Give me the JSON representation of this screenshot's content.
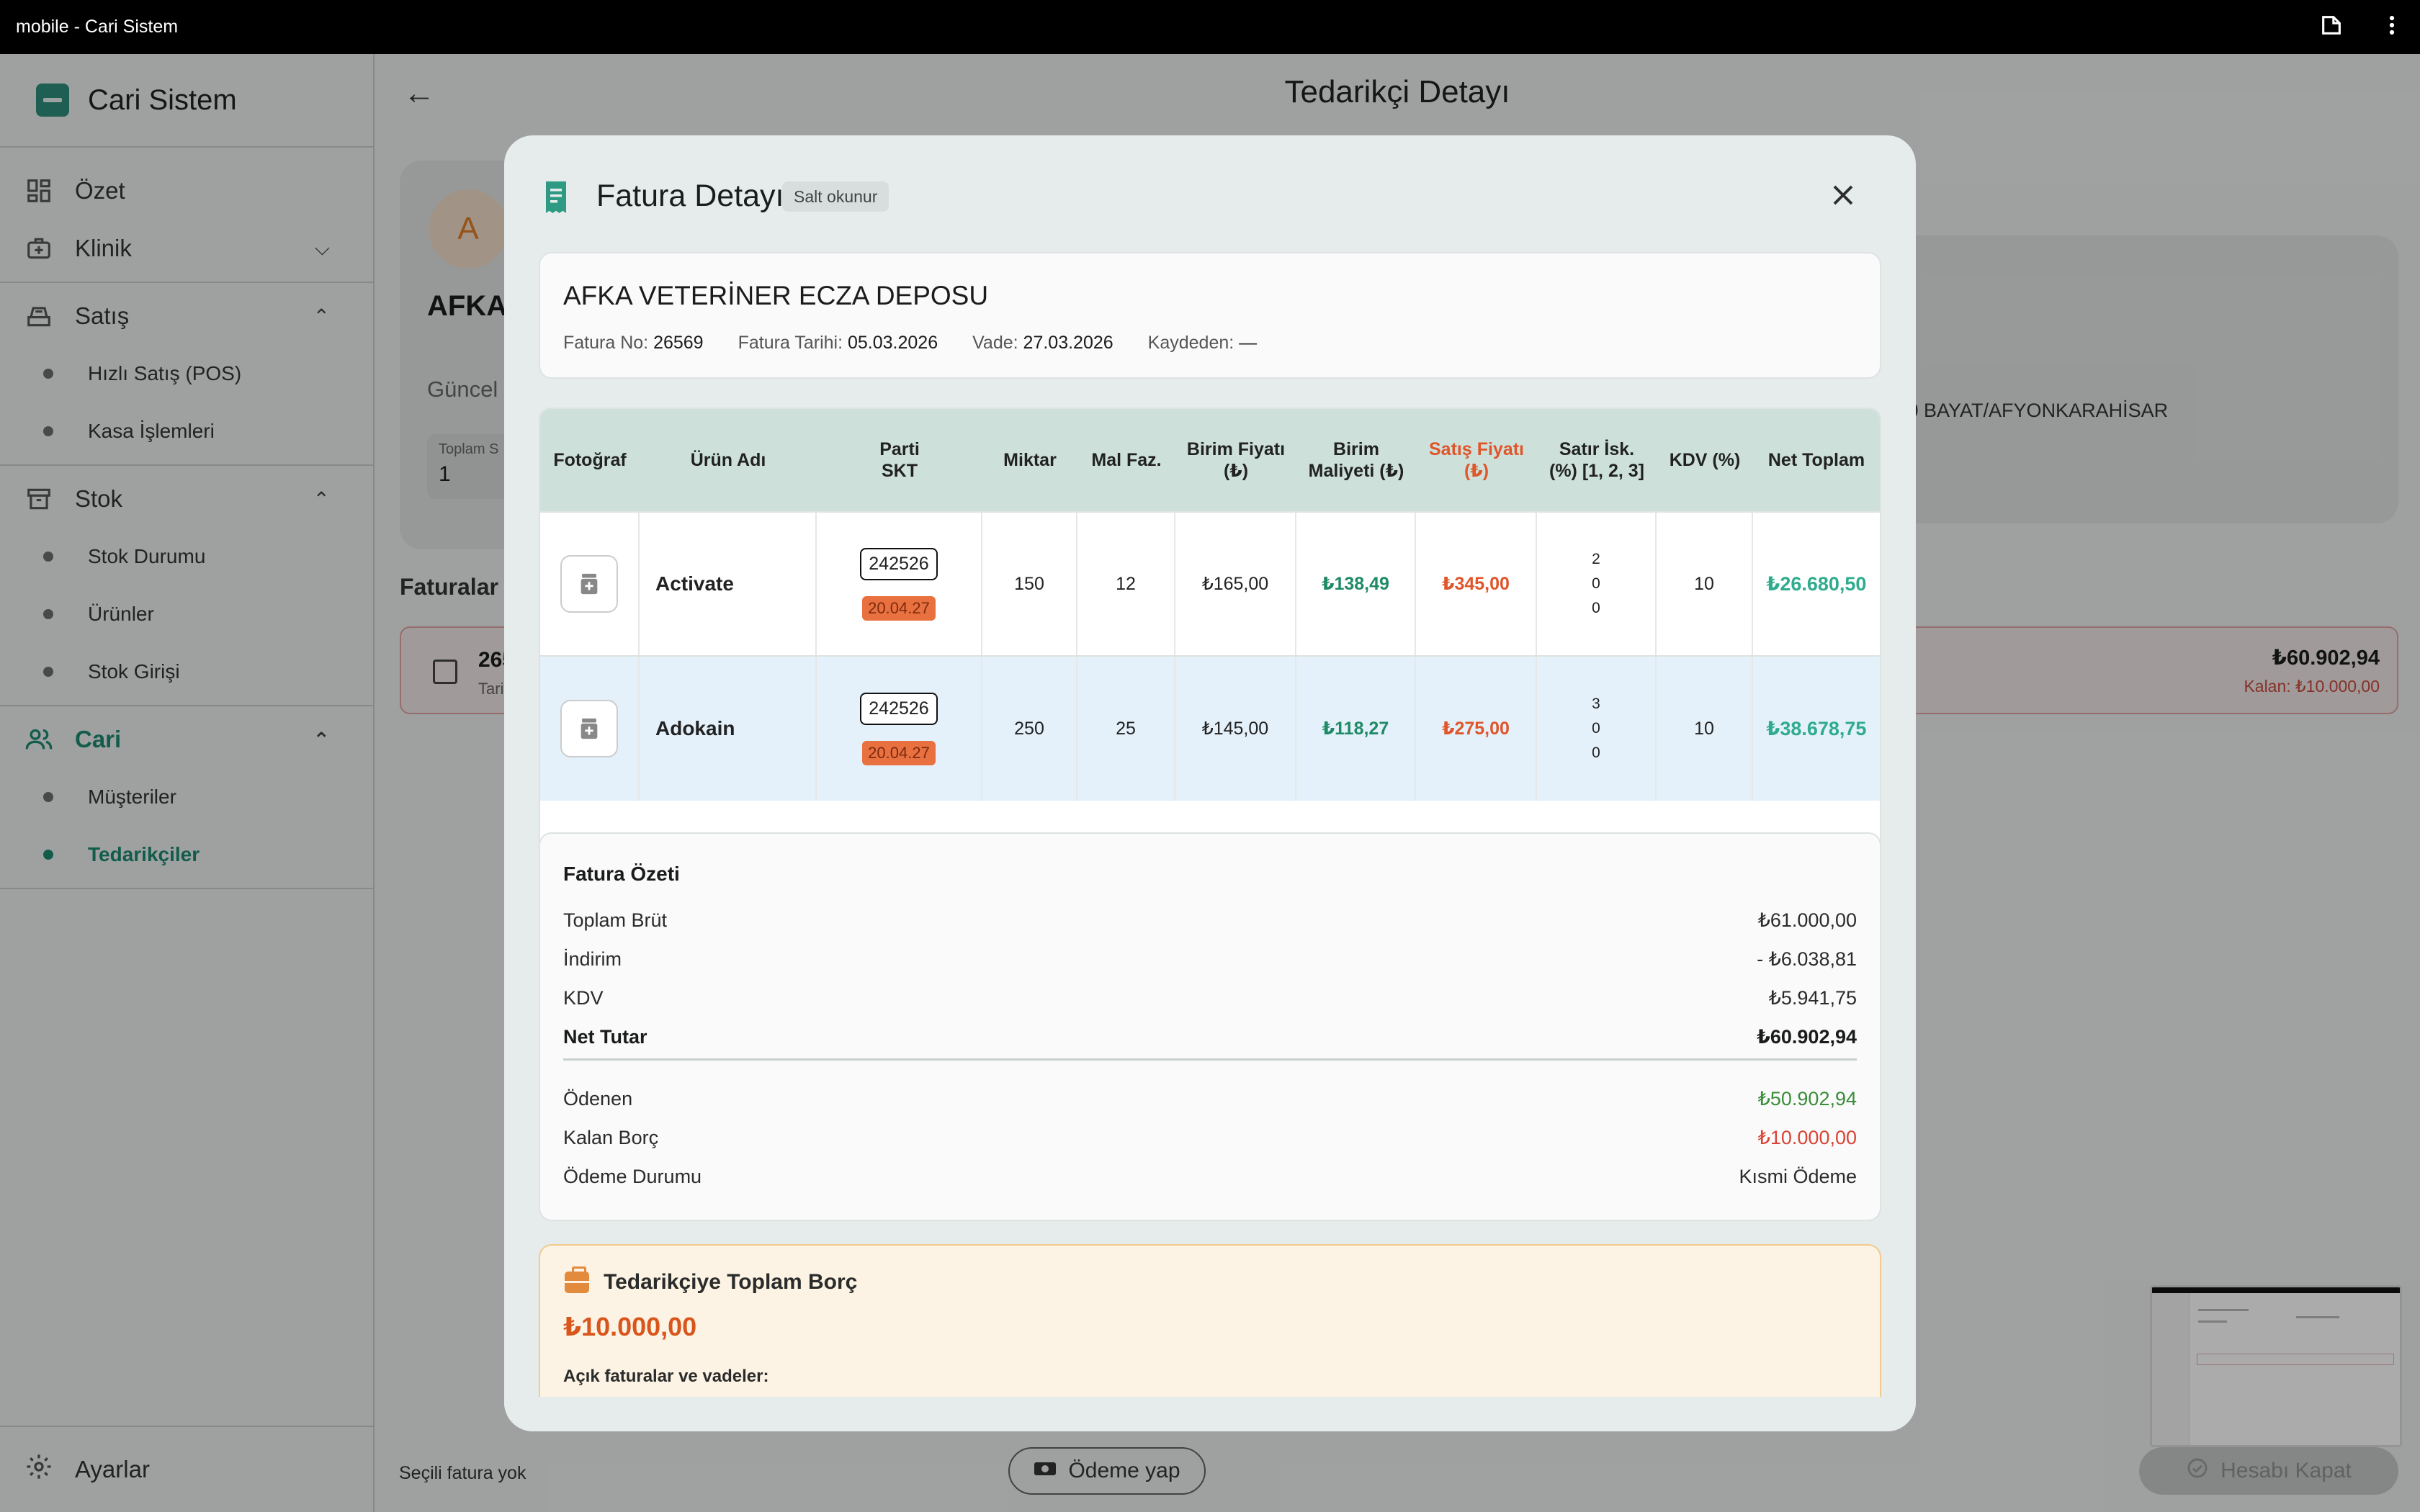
{
  "system_bar": {
    "title": "mobile - Cari Sistem",
    "icons": [
      "rotate-icon",
      "more-vert-icon"
    ]
  },
  "sidebar": {
    "app_name": "Cari Sistem",
    "items": [
      {
        "label": "Özet",
        "icon": "dashboard-icon"
      },
      {
        "label": "Klinik",
        "icon": "medical-bag-icon",
        "expanded": false
      },
      {
        "label": "Satış",
        "icon": "cash-register-icon",
        "expanded": true,
        "children": [
          "Hızlı Satış (POS)",
          "Kasa İşlemleri"
        ]
      },
      {
        "label": "Stok",
        "icon": "archive-icon",
        "expanded": true,
        "children": [
          "Stok Durumu",
          "Ürünler",
          "Stok Girişi"
        ]
      },
      {
        "label": "Cari",
        "icon": "people-icon",
        "expanded": true,
        "active": true,
        "children": [
          "Müşteriler",
          "Tedarikçiler"
        ]
      }
    ],
    "settings_label": "Ayarlar"
  },
  "page": {
    "title": "Tedarikçi Detayı",
    "supplier_avatar": "A",
    "supplier_short": "AFKA",
    "guncel_label": "Güncel",
    "total_label": "Toplam S",
    "total_value": "1",
    "address_fragment": "l 10 BAYAT/AFYONKARAHİSAR",
    "invoices_heading": "Faturalar",
    "invoice_row": {
      "no_fragment": "265",
      "date_fragment": "Tari",
      "amount": "₺60.902,94",
      "remaining": "Kalan: ₺10.000,00"
    },
    "bottom": {
      "selected_text": "Seçili fatura yok",
      "pay_button": "Ödeme yap",
      "close_account_button": "Hesabı Kapat"
    }
  },
  "modal": {
    "title": "Fatura Detayı",
    "badge": "Salt okunur",
    "supplier_name": "AFKA VETERİNER ECZA DEPOSU",
    "meta": [
      {
        "label": "Fatura No:",
        "value": "26569"
      },
      {
        "label": "Fatura Tarihi:",
        "value": "05.03.2026"
      },
      {
        "label": "Vade:",
        "value": "27.03.2026"
      },
      {
        "label": "Kaydeden:",
        "value": "—"
      }
    ],
    "table": {
      "headers": [
        "Fotoğraf",
        "Ürün Adı",
        "Parti\nSKT",
        "Miktar",
        "Mal Faz.",
        "Birim Fiyatı\n(₺)",
        "Birim\nMaliyeti (₺)",
        "Satış Fiyatı\n(₺)",
        "Satır İsk.\n(%) [1, 2, 3]",
        "KDV (%)",
        "Net Toplam"
      ],
      "rows": [
        {
          "product": "Activate",
          "lot": "242526",
          "skt": "20.04.27",
          "qty": "150",
          "free": "12",
          "unit_price": "₺165,00",
          "unit_cost": "₺138,49",
          "sale_price": "₺345,00",
          "disc": [
            "2",
            "0",
            "0"
          ],
          "vat": "10",
          "net": "₺26.680,50"
        },
        {
          "product": "Adokain",
          "lot": "242526",
          "skt": "20.04.27",
          "qty": "250",
          "free": "25",
          "unit_price": "₺145,00",
          "unit_cost": "₺118,27",
          "sale_price": "₺275,00",
          "disc": [
            "3",
            "0",
            "0"
          ],
          "vat": "10",
          "net": "₺38.678,75"
        }
      ]
    },
    "summary": {
      "title": "Fatura Özeti",
      "rows": [
        {
          "label": "Toplam Brüt",
          "value": "₺61.000,00"
        },
        {
          "label": "İndirim",
          "value": "- ₺6.038,81"
        },
        {
          "label": "KDV",
          "value": "₺5.941,75"
        },
        {
          "label": "Net Tutar",
          "value": "₺60.902,94"
        }
      ],
      "payment_rows": [
        {
          "label": "Ödenen",
          "value": "₺50.902,94"
        },
        {
          "label": "Kalan Borç",
          "value": "₺10.000,00"
        },
        {
          "label": "Ödeme Durumu",
          "value": "Kısmi Ödeme"
        }
      ]
    },
    "debt": {
      "title": "Tedarikçiye Toplam Borç",
      "amount": "₺10.000,00",
      "open_invoices_label": "Açık faturalar ve vadeler:"
    }
  },
  "colors": {
    "accent": "#1d8a72",
    "table_header": "#cde1da",
    "sale_price": "#e0552a",
    "cost": "#1f8a66",
    "net_total": "#2fab8e",
    "debt_amount": "#d8551b"
  }
}
